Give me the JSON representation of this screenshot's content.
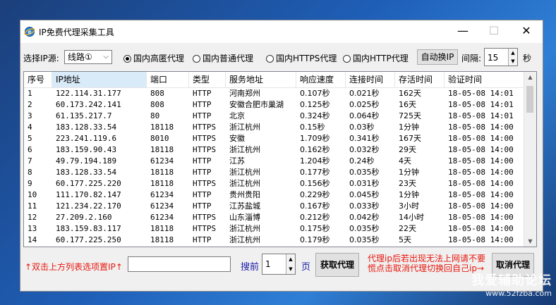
{
  "window": {
    "title": "IP免费代理采集工具",
    "minimize": "—",
    "maximize": "☐",
    "close": "✕"
  },
  "toolbar": {
    "source_label": "选择IP源:",
    "source_value": "线路①",
    "radios": [
      {
        "label": "国内高匿代理",
        "checked": true
      },
      {
        "label": "国内普通代理",
        "checked": false
      },
      {
        "label": "国内HTTPS代理",
        "checked": false
      },
      {
        "label": "国内HTTP代理",
        "checked": false
      }
    ],
    "auto_switch_label": "自动换IP",
    "interval_label": "间隔:",
    "interval_value": "15",
    "seconds_label": "秒"
  },
  "table": {
    "columns": [
      "序号",
      "IP地址",
      "端口",
      "类型",
      "服务地址",
      "响应速度",
      "连接时间",
      "存活时间",
      "验证时间"
    ],
    "rows": [
      [
        "1",
        "122.114.31.177",
        "808",
        "HTTP",
        "河南郑州",
        "0.107秒",
        "0.021秒",
        "162天",
        "18-05-08 14:01"
      ],
      [
        "2",
        "60.173.242.141",
        "808",
        "HTTP",
        "安徽合肥市巢湖",
        "0.125秒",
        "0.025秒",
        "16天",
        "18-05-08 14:01"
      ],
      [
        "3",
        "61.135.217.7",
        "80",
        "HTTP",
        "北京",
        "0.324秒",
        "0.064秒",
        "725天",
        "18-05-08 14:01"
      ],
      [
        "4",
        "183.128.33.54",
        "18118",
        "HTTPS",
        "浙江杭州",
        "0.15秒",
        "0.03秒",
        "1分钟",
        "18-05-08 14:00"
      ],
      [
        "5",
        "223.241.119.6",
        "8010",
        "HTTPS",
        "安徽",
        "1.709秒",
        "0.341秒",
        "167天",
        "18-05-08 14:00"
      ],
      [
        "6",
        "183.159.90.43",
        "18118",
        "HTTPS",
        "浙江杭州",
        "0.162秒",
        "0.032秒",
        "29天",
        "18-05-08 14:00"
      ],
      [
        "7",
        "49.79.194.189",
        "61234",
        "HTTP",
        "江苏",
        "1.204秒",
        "0.24秒",
        "4天",
        "18-05-08 14:00"
      ],
      [
        "8",
        "183.128.33.54",
        "18118",
        "HTTP",
        "浙江杭州",
        "0.177秒",
        "0.035秒",
        "1分钟",
        "18-05-08 14:00"
      ],
      [
        "9",
        "60.177.225.220",
        "18118",
        "HTTPS",
        "浙江杭州",
        "0.156秒",
        "0.031秒",
        "23天",
        "18-05-08 14:00"
      ],
      [
        "10",
        "111.170.82.147",
        "61234",
        "HTTP",
        "贵州贵阳",
        "0.229秒",
        "0.045秒",
        "1分钟",
        "18-05-08 14:00"
      ],
      [
        "11",
        "121.234.22.170",
        "61234",
        "HTTP",
        "江苏盐城",
        "0.167秒",
        "0.033秒",
        "3小时",
        "18-05-08 14:00"
      ],
      [
        "12",
        "27.209.2.160",
        "61234",
        "HTTPS",
        "山东淄博",
        "0.212秒",
        "0.042秒",
        "14小时",
        "18-05-08 14:00"
      ],
      [
        "13",
        "183.159.83.117",
        "18118",
        "HTTPS",
        "浙江杭州",
        "0.175秒",
        "0.035秒",
        "22天",
        "18-05-08 14:00"
      ],
      [
        "14",
        "60.177.225.250",
        "18118",
        "HTTP",
        "浙江杭州",
        "0.179秒",
        "0.035秒",
        "5天",
        "18-05-08 14:00"
      ]
    ]
  },
  "bottom": {
    "hint": "↑双击上方列表选项置IP↑",
    "ip_value": "",
    "page_prefix": "搜前",
    "page_value": "1",
    "page_suffix": "页",
    "fetch_label": "获取代理",
    "note": "代理ip后若出现无法上网请不要慌点击取消代理切换回自己ip→",
    "cancel_label": "取消代理"
  },
  "watermark": {
    "line1": "我爱辅助论坛",
    "line2": "www.52fzba.com"
  }
}
